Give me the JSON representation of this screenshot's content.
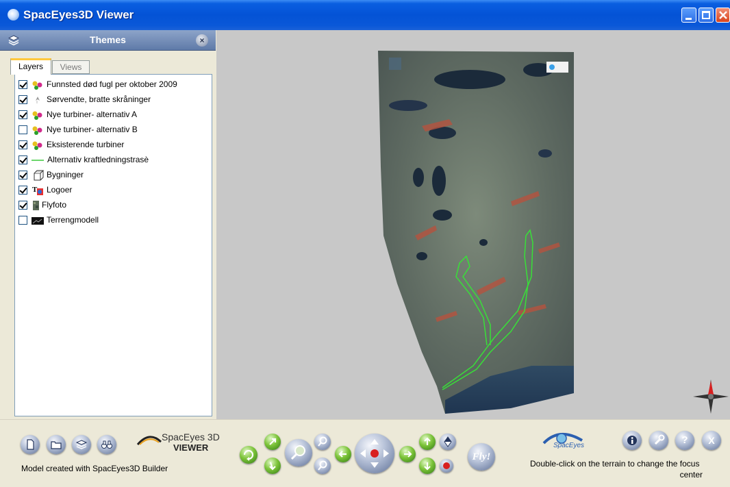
{
  "window": {
    "title": "SpacEyes3D Viewer",
    "accent_color": "#0453d6"
  },
  "themes": {
    "title": "Themes",
    "tabs": [
      {
        "label": "Layers",
        "active": true
      },
      {
        "label": "Views",
        "active": false
      }
    ],
    "layers": [
      {
        "label": "Funnsted død fugl per oktober 2009",
        "checked": true,
        "icon": "point-symbols-icon"
      },
      {
        "label": "Sørvendte, bratte skråninger",
        "checked": true,
        "icon": "arrow-symbol-icon"
      },
      {
        "label": "Nye turbiner- alternativ A",
        "checked": true,
        "icon": "point-symbols-icon"
      },
      {
        "label": "Nye turbiner- alternativ B",
        "checked": false,
        "icon": "point-symbols-icon"
      },
      {
        "label": "Eksisterende turbiner",
        "checked": true,
        "icon": "point-symbols-icon"
      },
      {
        "label": "Alternativ kraftledningstrasè",
        "checked": true,
        "icon": "green-line-icon"
      },
      {
        "label": "Bygninger",
        "checked": true,
        "icon": "building-icon"
      },
      {
        "label": "Logoer",
        "checked": true,
        "icon": "logo-layer-icon"
      },
      {
        "label": "Flyfoto",
        "checked": true,
        "icon": "aerial-photo-icon"
      },
      {
        "label": "Terrengmodell",
        "checked": false,
        "icon": "terrain-icon"
      }
    ]
  },
  "toolbar": {
    "brand_line1": "SpacEyes 3D",
    "brand_line2": "VIEWER",
    "model_text": "Model created with SpacEyes3D Builder",
    "fly_label": "Fly!",
    "spaceyes_logo_text": "SpacEyes",
    "hint_line1": "Double-click on the terrain to change the focus",
    "hint_line2": "center"
  }
}
